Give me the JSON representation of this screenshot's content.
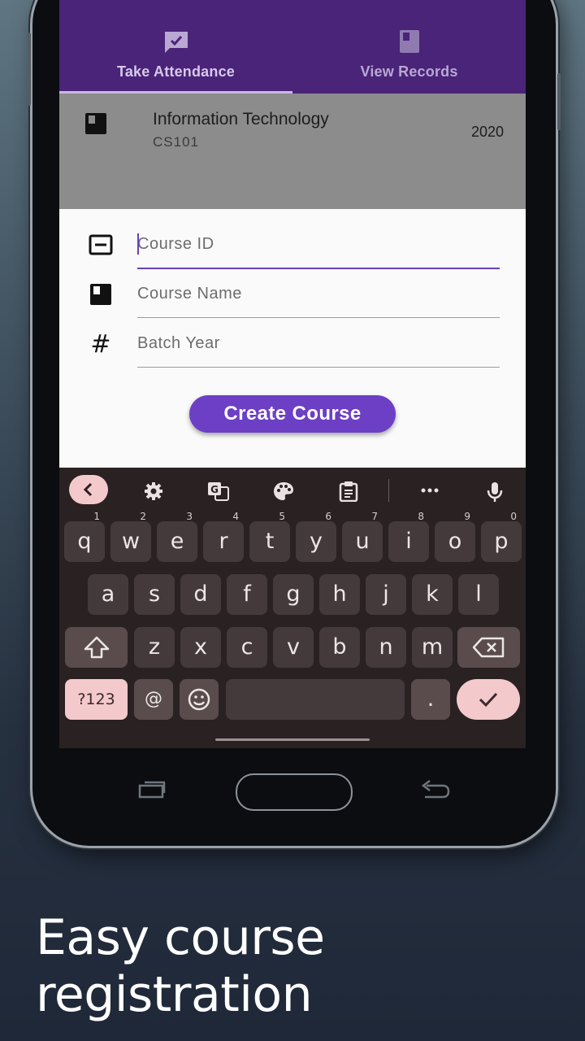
{
  "tabs": [
    {
      "label": "Take Attendance",
      "icon": "attendance-icon",
      "active": true
    },
    {
      "label": "View Records",
      "icon": "book-icon",
      "active": false
    }
  ],
  "course_list": [
    {
      "title": "Information Technology",
      "code": "CS101",
      "year": "2020",
      "icon": "book-icon"
    }
  ],
  "form": {
    "course_id_placeholder": "Course ID",
    "course_name_placeholder": "Course Name",
    "batch_year_placeholder": "Batch Year",
    "create_label": "Create Course"
  },
  "keyboard": {
    "row1": [
      "q",
      "w",
      "e",
      "r",
      "t",
      "y",
      "u",
      "i",
      "o",
      "p"
    ],
    "row1_hints": [
      "1",
      "2",
      "3",
      "4",
      "5",
      "6",
      "7",
      "8",
      "9",
      "0"
    ],
    "row2": [
      "a",
      "s",
      "d",
      "f",
      "g",
      "h",
      "j",
      "k",
      "l"
    ],
    "row3": [
      "z",
      "x",
      "c",
      "v",
      "b",
      "n",
      "m"
    ],
    "symbols_label": "?123",
    "at_label": "@",
    "period_label": "."
  },
  "caption": "Easy course registration",
  "colors": {
    "primary": "#4a2478",
    "accent": "#6c3fc5",
    "keyboard_bg": "#2a2122",
    "key_pink": "#f3c9cc"
  }
}
